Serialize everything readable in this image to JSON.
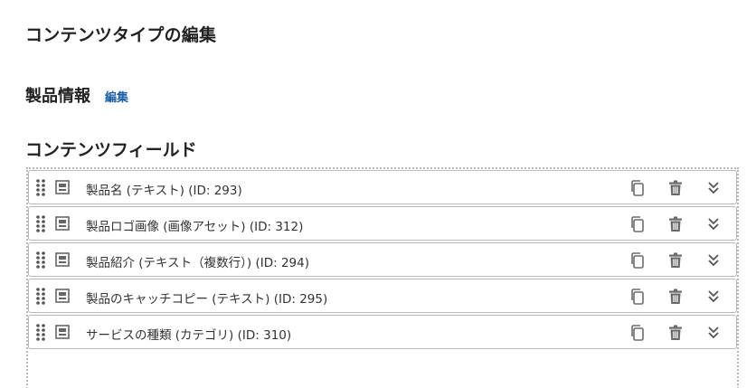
{
  "page": {
    "title": "コンテンツタイプの編集"
  },
  "content_type": {
    "name": "製品情報",
    "edit_label": "編集"
  },
  "section": {
    "title": "コンテンツフィールド"
  },
  "fields": [
    {
      "label": "製品名 (テキスト) (ID: 293)"
    },
    {
      "label": "製品ロゴ画像 (画像アセット) (ID: 312)"
    },
    {
      "label": "製品紹介 (テキスト（複数行）) (ID: 294)"
    },
    {
      "label": "製品のキャッチコピー (テキスト) (ID: 295)"
    },
    {
      "label": "サービスの種類 (カテゴリ) (ID: 310)"
    }
  ],
  "icons": {
    "drag": "drag-handle-icon",
    "field_type": "field-type-icon",
    "copy": "copy-icon",
    "delete": "trash-icon",
    "expand": "chevron-double-down-icon"
  },
  "colors": {
    "link": "#1a5fa8",
    "icon": "#6b6b6b",
    "border": "#b9b9b9"
  }
}
